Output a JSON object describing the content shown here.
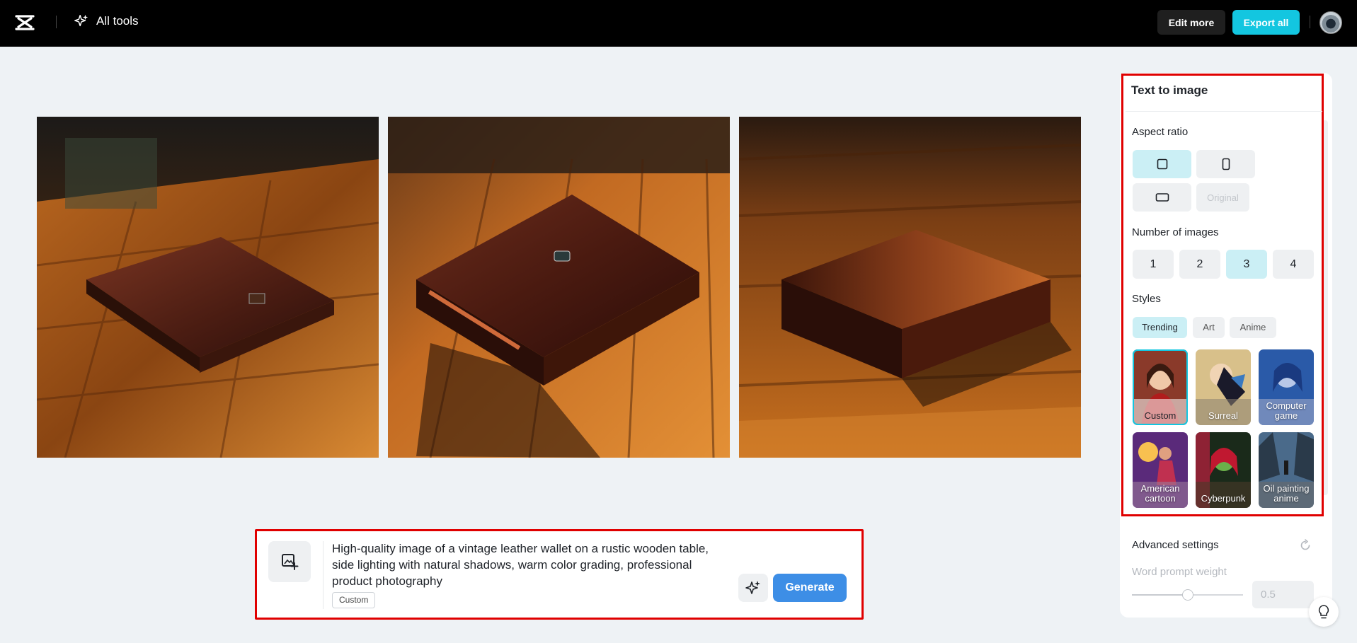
{
  "topbar": {
    "all_tools_label": "All tools",
    "edit_more_label": "Edit more",
    "export_all_label": "Export all"
  },
  "prompt": {
    "text": "High-quality image of a vintage leather wallet on a rustic wooden table, side lighting with natural shadows, warm color grading, professional product photography",
    "style_tag": "Custom",
    "generate_label": "Generate"
  },
  "panel": {
    "title": "Text to image",
    "aspect_ratio_label": "Aspect ratio",
    "aspect_original_label": "Original",
    "number_of_images_label": "Number of images",
    "numbers": [
      "1",
      "2",
      "3",
      "4"
    ],
    "selected_number": "3",
    "styles_label": "Styles",
    "style_tabs": [
      "Trending",
      "Art",
      "Anime"
    ],
    "styles": [
      {
        "name": "Custom"
      },
      {
        "name": "Surreal"
      },
      {
        "name": "Computer game"
      },
      {
        "name": "American cartoon"
      },
      {
        "name": "Cyberpunk"
      },
      {
        "name": "Oil painting anime"
      }
    ],
    "advanced_label": "Advanced settings",
    "word_prompt_weight_label": "Word prompt weight",
    "word_prompt_weight_value": "0.5"
  },
  "colors": {
    "accent": "#13c6e0",
    "generate": "#3d8ee6",
    "highlight_border": "#e00000"
  }
}
